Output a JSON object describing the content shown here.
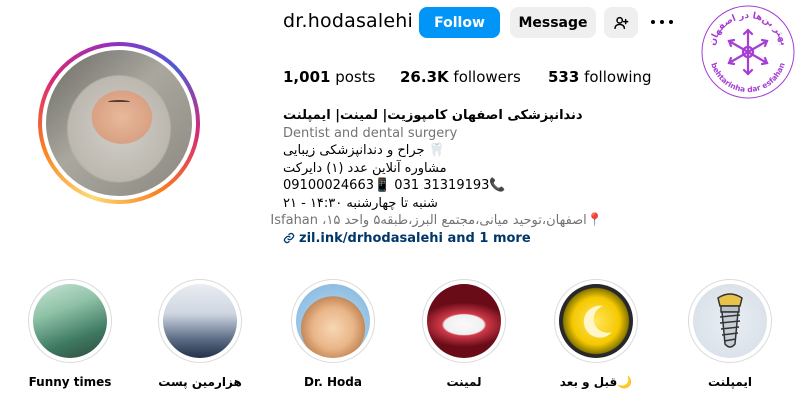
{
  "profile": {
    "username": "dr.hodasalehi",
    "follow_label": "Follow",
    "message_label": "Message"
  },
  "stats": {
    "posts_count": "1,001",
    "posts_label": "posts",
    "followers_count": "26.3K",
    "followers_label": "followers",
    "following_count": "533",
    "following_label": "following"
  },
  "bio": {
    "name": "دندانپزشکی اصفهان کامپوزیت| لمینت| ایمپلنت",
    "category": "Dentist and dental surgery",
    "line1": "🦷 جراح و دندانپزشکی زیبایی",
    "line2": "مشاوره آنلاین عدد (۱) دایرکت",
    "line3": "09100024663📱 031 31319193📞",
    "line4": "شنبه تا چهارشنبه ۱۴:۳۰ - ۲۱",
    "address": "📍اصفهان،توحید میانی،مجتمع البرز،طبقه۵ واحد ۱۵، Isfahan",
    "link_text": "zil.ink/drhodasalehi and 1 more"
  },
  "stamp": {
    "top_text": "بهتر بن‌ها در اصفهان",
    "bottom_text": "behtarinha dar esfahan"
  },
  "highlights": [
    {
      "label": "Funny times"
    },
    {
      "label": "هزارمین پست"
    },
    {
      "label": "Dr. Hoda"
    },
    {
      "label": "لمینت"
    },
    {
      "label": "قبل و بعد🌙"
    },
    {
      "label": "ایمپلنت"
    }
  ],
  "colors": {
    "follow_button": "#0095f6",
    "secondary_button": "#efefef",
    "link": "#00376b",
    "muted_text": "#737373",
    "stamp_purple": "#a43ed4"
  },
  "icons": {
    "add_user": "add-user-icon",
    "more": "more-options-icon",
    "link": "link-icon"
  }
}
